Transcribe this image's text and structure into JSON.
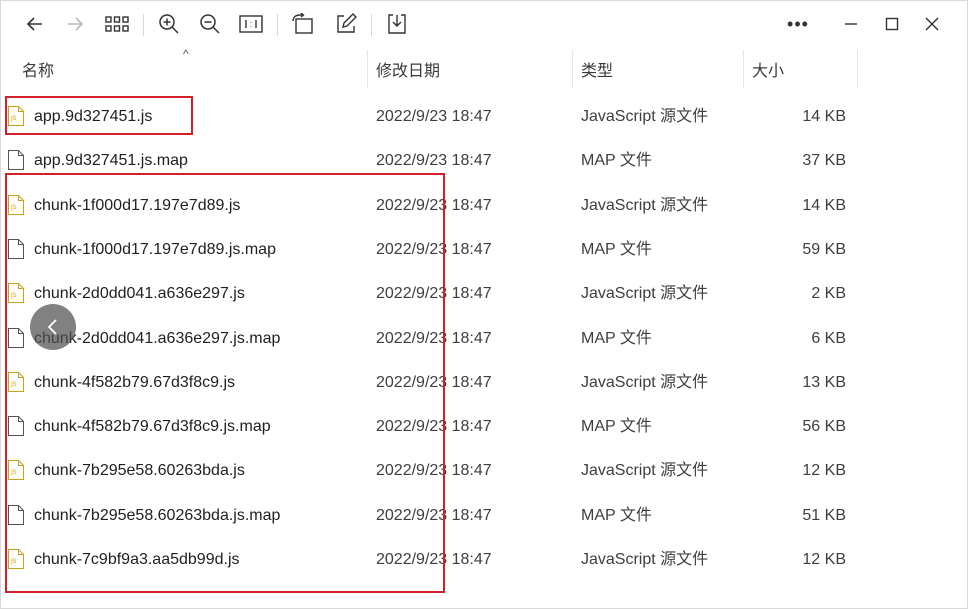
{
  "toolbar": {
    "back_icon": "arrow-left-icon",
    "forward_icon": "arrow-right-icon",
    "more_label": "•••"
  },
  "columns": {
    "name": "名称",
    "date": "修改日期",
    "type": "类型",
    "size": "大小"
  },
  "sort_indicator": "^",
  "files": [
    {
      "name": "app.9d327451.js",
      "date": "2022/9/23 18:47",
      "type": "JavaScript 源文件",
      "size": "14 KB",
      "icon": "js-file-icon"
    },
    {
      "name": "app.9d327451.js.map",
      "date": "2022/9/23 18:47",
      "type": "MAP 文件",
      "size": "37 KB",
      "icon": "file-icon"
    },
    {
      "name": "chunk-1f000d17.197e7d89.js",
      "date": "2022/9/23 18:47",
      "type": "JavaScript 源文件",
      "size": "14 KB",
      "icon": "js-file-icon"
    },
    {
      "name": "chunk-1f000d17.197e7d89.js.map",
      "date": "2022/9/23 18:47",
      "type": "MAP 文件",
      "size": "59 KB",
      "icon": "file-icon"
    },
    {
      "name": "chunk-2d0dd041.a636e297.js",
      "date": "2022/9/23 18:47",
      "type": "JavaScript 源文件",
      "size": "2 KB",
      "icon": "js-file-icon"
    },
    {
      "name": "chunk-2d0dd041.a636e297.js.map",
      "date": "2022/9/23 18:47",
      "type": "MAP 文件",
      "size": "6 KB",
      "icon": "file-icon"
    },
    {
      "name": "chunk-4f582b79.67d3f8c9.js",
      "date": "2022/9/23 18:47",
      "type": "JavaScript 源文件",
      "size": "13 KB",
      "icon": "js-file-icon"
    },
    {
      "name": "chunk-4f582b79.67d3f8c9.js.map",
      "date": "2022/9/23 18:47",
      "type": "MAP 文件",
      "size": "56 KB",
      "icon": "file-icon"
    },
    {
      "name": "chunk-7b295e58.60263bda.js",
      "date": "2022/9/23 18:47",
      "type": "JavaScript 源文件",
      "size": "12 KB",
      "icon": "js-file-icon"
    },
    {
      "name": "chunk-7b295e58.60263bda.js.map",
      "date": "2022/9/23 18:47",
      "type": "MAP 文件",
      "size": "51 KB",
      "icon": "file-icon"
    },
    {
      "name": "chunk-7c9bf9a3.aa5db99d.js",
      "date": "2022/9/23 18:47",
      "type": "JavaScript 源文件",
      "size": "12 KB",
      "icon": "js-file-icon"
    }
  ],
  "colors": {
    "annotation_red": "#d2202a",
    "js_icon_yellow": "#c9a21a"
  }
}
